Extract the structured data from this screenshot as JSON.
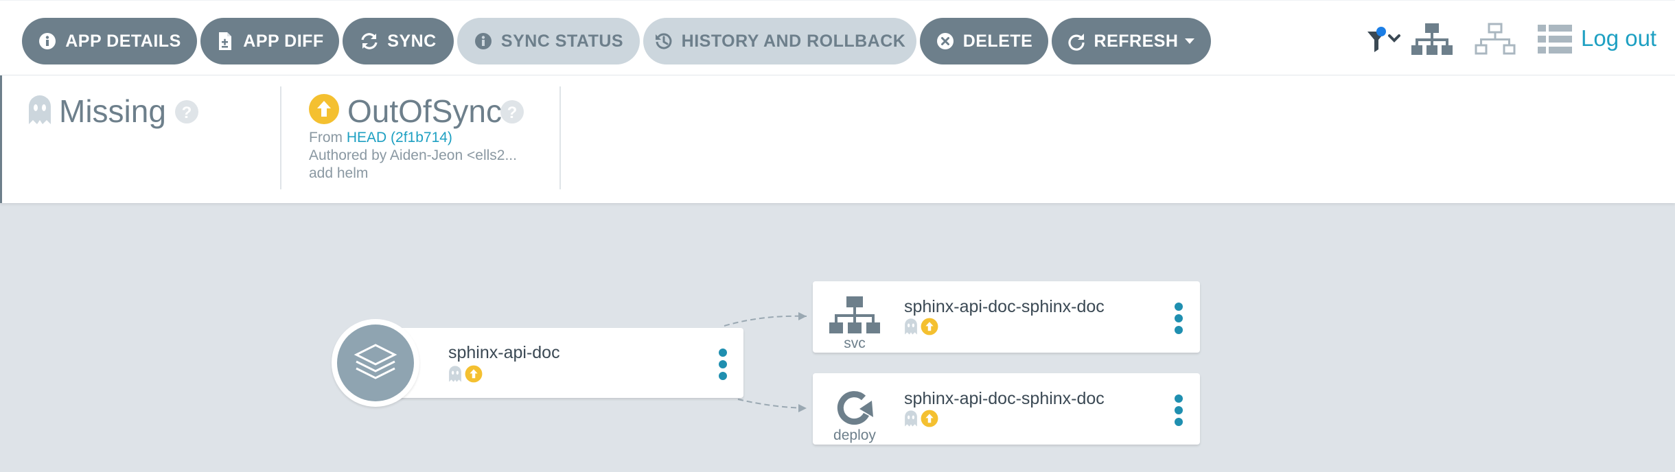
{
  "toolbar": {
    "buttons": [
      {
        "label": "APP DETAILS",
        "icon": "info-circle-icon"
      },
      {
        "label": "APP DIFF",
        "icon": "file-diff-icon"
      },
      {
        "label": "SYNC",
        "icon": "sync-icon"
      },
      {
        "label": "SYNC STATUS",
        "icon": "info-circle-icon"
      },
      {
        "label": "HISTORY AND ROLLBACK",
        "icon": "history-icon"
      },
      {
        "label": "DELETE",
        "icon": "times-circle-icon"
      },
      {
        "label": "REFRESH",
        "icon": "redo-icon"
      }
    ],
    "logout_label": "Log out"
  },
  "status": {
    "health": {
      "label": "Missing",
      "icon": "ghost-icon"
    },
    "sync": {
      "label": "OutOfSync",
      "icon": "arrow-up-circle-icon",
      "from_prefix": "From",
      "revision": "HEAD (2f1b714)",
      "author": "Authored by Aiden-Jeon <ells2...",
      "message": "add helm"
    }
  },
  "graph": {
    "app_node": {
      "name": "sphinx-api-doc"
    },
    "children": [
      {
        "name": "sphinx-api-doc-sphinx-doc",
        "kind": "svc"
      },
      {
        "name": "sphinx-api-doc-sphinx-doc",
        "kind": "deploy"
      }
    ]
  },
  "colors": {
    "button_dark": "#6d7f8b",
    "button_light": "#ccd6dd",
    "accent_link": "#1ea0c2",
    "out_of_sync": "#f4c030",
    "missing": "#ccd6dd",
    "canvas_bg": "#dee3e8"
  }
}
